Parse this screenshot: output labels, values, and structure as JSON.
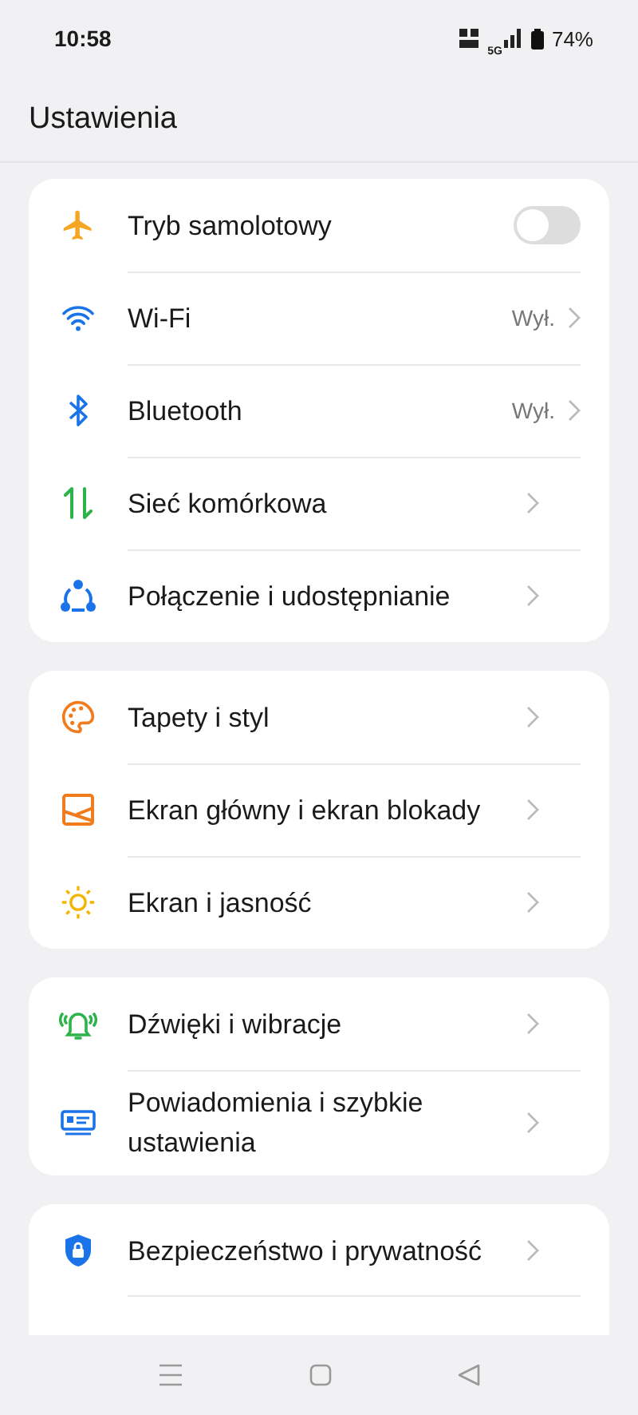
{
  "status_bar": {
    "time": "10:58",
    "network": "5G",
    "battery": "74%"
  },
  "title": "Ustawienia",
  "sections": [
    {
      "items": [
        {
          "kind": "toggle",
          "label": "Tryb samolotowy",
          "on": false
        },
        {
          "kind": "link",
          "label": "Wi-Fi",
          "value": "Wył."
        },
        {
          "kind": "link",
          "label": "Bluetooth",
          "value": "Wył."
        },
        {
          "kind": "link",
          "label": "Sieć komórkowa"
        },
        {
          "kind": "link",
          "label": "Połączenie i udostępnianie"
        }
      ]
    },
    {
      "items": [
        {
          "kind": "link",
          "label": "Tapety i styl"
        },
        {
          "kind": "link",
          "label": "Ekran główny i ekran blokady"
        },
        {
          "kind": "link",
          "label": "Ekran i jasność"
        }
      ]
    },
    {
      "items": [
        {
          "kind": "link",
          "label": "Dźwięki i wibracje"
        },
        {
          "kind": "link",
          "label": "Powiadomienia i szybkie ustawienia"
        }
      ]
    },
    {
      "items": [
        {
          "kind": "link",
          "label": "Bezpieczeństwo i prywatność"
        }
      ]
    }
  ]
}
